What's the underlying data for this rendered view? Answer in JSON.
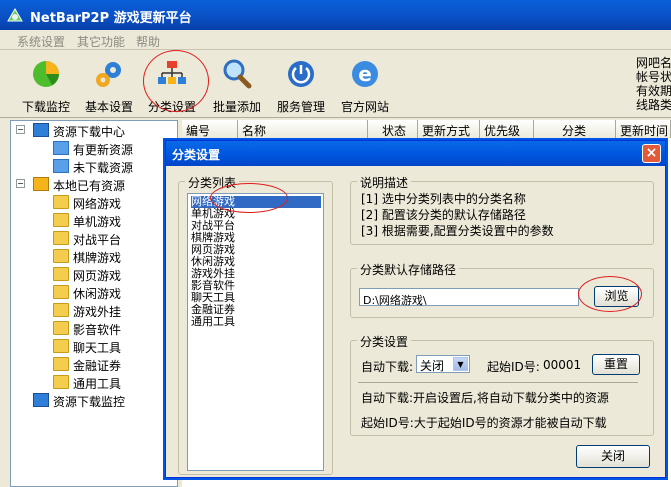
{
  "window": {
    "title": "NetBarP2P 游戏更新平台"
  },
  "menu": [
    "系统设置",
    "其它功能",
    "帮助"
  ],
  "toolbar": [
    {
      "label": "下载监控",
      "icon": "download-monitor-icon"
    },
    {
      "label": "基本设置",
      "icon": "gears-icon"
    },
    {
      "label": "分类设置",
      "icon": "category-tree-icon"
    },
    {
      "label": "批量添加",
      "icon": "magnifier-icon"
    },
    {
      "label": "服务管理",
      "icon": "power-icon"
    },
    {
      "label": "官方网站",
      "icon": "ie-icon"
    }
  ],
  "right_info": [
    "网吧名",
    "帐号状",
    "有效期",
    "线路类"
  ],
  "tree": {
    "root1": "资源下载中心",
    "root1_children": [
      "有更新资源",
      "未下载资源"
    ],
    "root2": "本地已有资源",
    "root2_children": [
      "网络游戏",
      "单机游戏",
      "对战平台",
      "棋牌游戏",
      "网页游戏",
      "休闲游戏",
      "游戏外挂",
      "影音软件",
      "聊天工具",
      "金融证券",
      "通用工具"
    ],
    "root3": "资源下载监控"
  },
  "table": {
    "columns": [
      "编号",
      "名称",
      "状态",
      "更新方式",
      "优先级",
      "分类",
      "更新时间"
    ]
  },
  "dialog": {
    "title": "分类设置",
    "list_group": "分类列表",
    "categories": [
      "网络游戏",
      "单机游戏",
      "对战平台",
      "棋牌游戏",
      "网页游戏",
      "休闲游戏",
      "游戏外挂",
      "影音软件",
      "聊天工具",
      "金融证券",
      "通用工具"
    ],
    "selected_index": 0,
    "desc_group": "说明描述",
    "desc_lines": [
      "[1] 选中分类列表中的分类名称",
      "[2] 配置该分类的默认存储路径",
      "[3] 根据需要,配置分类设置中的参数"
    ],
    "path_group": "分类默认存储路径",
    "path_value": "D:\\网络游戏\\",
    "browse_label": "浏览",
    "settings_group": "分类设置",
    "auto_label": "自动下载:",
    "auto_value": "关闭",
    "start_id_label": "起始ID号:",
    "start_id_value": "00001",
    "reset_label": "重置",
    "note1": "自动下载:开启设置后,将自动下载分类中的资源",
    "note2": "起始ID号:大于起始ID号的资源才能被自动下载",
    "close_label": "关闭"
  },
  "colors": {
    "accent": "#0a5fd8",
    "selection": "#316ac5",
    "annotation": "#e21b1b"
  }
}
